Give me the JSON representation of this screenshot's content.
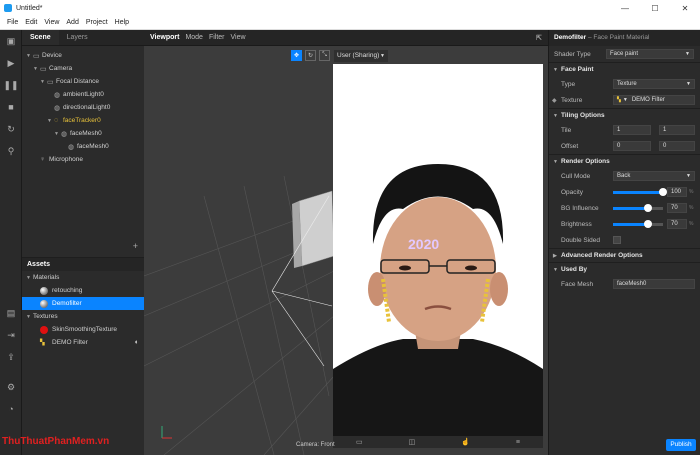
{
  "window": {
    "title": "Untitled*",
    "minimize": "—",
    "maximize": "☐",
    "close": "✕"
  },
  "menu": [
    "File",
    "Edit",
    "View",
    "Add",
    "Project",
    "Help"
  ],
  "scene": {
    "tabs": [
      "Scene",
      "Layers"
    ],
    "tree": [
      {
        "label": "Device",
        "depth": 0,
        "icon": "▭"
      },
      {
        "label": "Camera",
        "depth": 1,
        "icon": "▭"
      },
      {
        "label": "Focal Distance",
        "depth": 2,
        "icon": "▭"
      },
      {
        "label": "ambientLight0",
        "depth": 3,
        "icon": "◍"
      },
      {
        "label": "directionalLight0",
        "depth": 3,
        "icon": "◍"
      },
      {
        "label": "faceTracker0",
        "depth": 3,
        "icon": "◌"
      },
      {
        "label": "faceMesh0",
        "depth": 4,
        "icon": "◍"
      },
      {
        "label": "faceMesh0",
        "depth": 5,
        "icon": "◍"
      },
      {
        "label": "Microphone",
        "depth": 1,
        "icon": "♀"
      }
    ],
    "add_label": "+"
  },
  "assets": {
    "title": "Assets",
    "sections": {
      "materials": "Materials",
      "textures": "Textures"
    },
    "materials": [
      "retouching",
      "Demofilter"
    ],
    "textures": [
      "SkinSmoothingTexture",
      "DEMO Filter"
    ],
    "selected": "Demofilter"
  },
  "viewport": {
    "tabs": [
      "Viewport",
      "Mode",
      "Filter",
      "View"
    ],
    "device": "User (Sharing)",
    "camera_label": "Camera: Front"
  },
  "properties": {
    "title": "Demofilter",
    "subtitle": "– Face Paint Material",
    "shader_type_label": "Shader Type",
    "shader_type_value": "Face paint",
    "sections": {
      "face_paint": "Face Paint",
      "tiling": "Tiling Options",
      "render": "Render Options",
      "advanced": "Advanced Render Options",
      "used_by": "Used By"
    },
    "type_label": "Type",
    "type_value": "Texture",
    "texture_label": "Texture",
    "texture_value": "DEMO Filter",
    "tile_label": "Tile",
    "tile_values": [
      "1",
      "1"
    ],
    "offset_label": "Offset",
    "offset_values": [
      "0",
      "0"
    ],
    "cull_mode_label": "Cull Mode",
    "cull_mode_value": "Back",
    "opacity_label": "Opacity",
    "opacity_value": "100",
    "bg_influence_label": "BG Influence",
    "bg_influence_value": "70",
    "brightness_label": "Brightness",
    "brightness_value": "70",
    "double_sided_label": "Double Sided",
    "face_mesh_label": "Face Mesh",
    "face_mesh_value": "faceMesh0",
    "percent": "%",
    "publish_label": "Publish"
  },
  "watermark": "ThuThuatPhanMem.vn",
  "colors": {
    "accent": "#0a84ff",
    "highlight": "#e8c23a"
  }
}
